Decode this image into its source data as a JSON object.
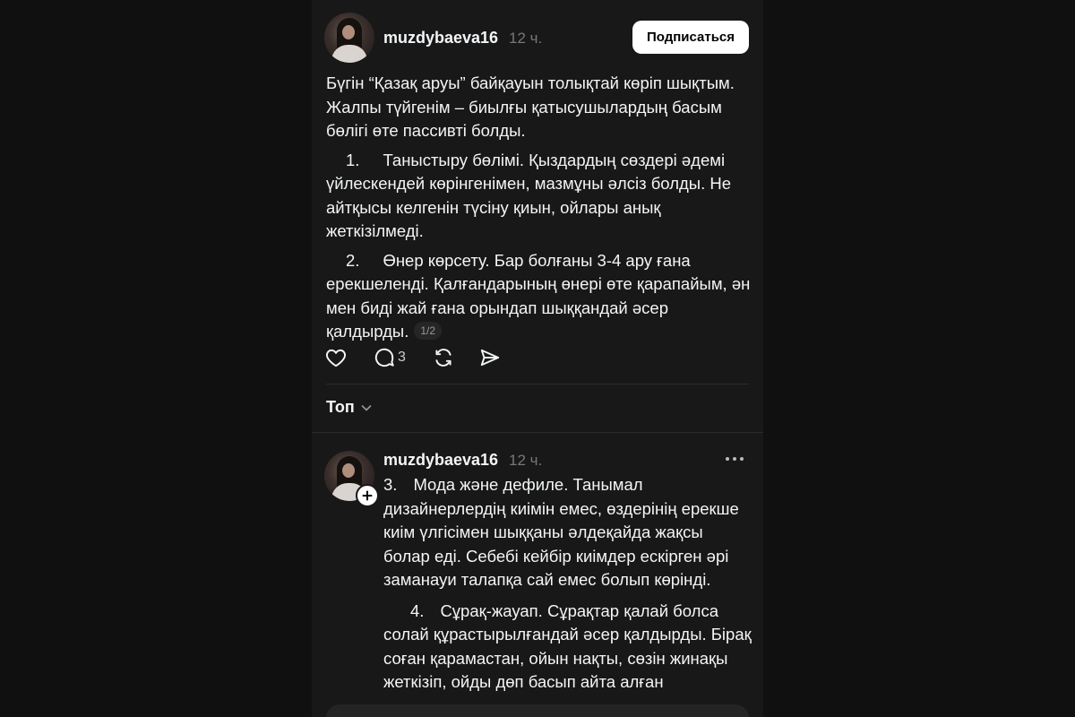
{
  "post": {
    "username": "muzdybaeva16",
    "time": "12 ч.",
    "follow_label": "Подписаться",
    "intro": "Бүгін “Қазақ аруы” байқауын толықтай көріп шықтым. Жалпы түйгенім – биылғы қатысушылардың басым бөлігі өте пассивті болды.",
    "items": [
      {
        "num": "1.",
        "text": "Таныстыру бөлімі. Қыздардың сөздері әдемі үйлескендей көрінгенімен, мазмұны әлсіз болды. Не айтқысы келгенін түсіну қиын, ойлары анық жеткізілмеді."
      },
      {
        "num": "2.",
        "text": "Өнер көрсету. Бар болғаны 3-4 ару ғана ерекшеленді. Қалғандарының өнері өте қарапайым, ән мен биді жай ғана орындап шыққандай әсер қалдырды."
      }
    ],
    "page_indicator": "1/2",
    "actions": {
      "like_icon": "heart-icon",
      "comment_icon": "comment-icon",
      "comment_count": "3",
      "repost_icon": "repost-icon",
      "share_icon": "send-icon"
    }
  },
  "sort": {
    "label": "Топ",
    "icon": "chevron-down-icon"
  },
  "reply": {
    "username": "muzdybaeva16",
    "time": "12 ч.",
    "more_icon": "more-icon",
    "follow_icon": "plus-icon",
    "items": [
      {
        "num": "3.",
        "text": "Мода және дефиле. Танымал дизайнерлердің киімін емес, өздерінің ерекше киім үлгісімен шыққаны әлдеқайда жақсы болар еді. Себебі кейбір киімдер ескірген әрі заманауи талапқа сай емес болып көрінді."
      },
      {
        "num": "4.",
        "text": "Сұрақ-жауап. Сұрақтар қалай болса солай құрастырылғандай әсер қалдырды. Бірақ соған қарамастан, ойын нақты, сөзін жинақы жеткізіп, ойды дөп басып айта алған"
      }
    ]
  },
  "colors": {
    "background": "#101010",
    "surface": "#181818",
    "text": "#f3f5f7",
    "muted": "#777777",
    "button_bg": "#ffffff",
    "button_text": "#000000"
  }
}
